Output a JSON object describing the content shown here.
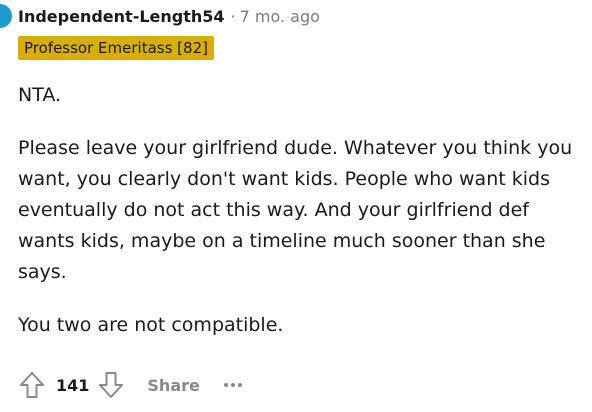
{
  "comment": {
    "author": "Independent-Length54",
    "separator": "·",
    "time": "7 mo. ago",
    "flair": "Professor Emeritass [82]",
    "paragraphs": [
      "NTA.",
      "Please leave your girlfriend dude. Whatever you think you want, you clearly don't want kids. People who want kids eventually do not act this way. And your girlfriend def wants kids, maybe on a timeline much sooner than she says.",
      "You two are not compatible."
    ],
    "score": "141",
    "share_label": "Share",
    "more_label": "···"
  },
  "icons": {
    "upvote": "upvote-arrow-icon",
    "downvote": "downvote-arrow-icon",
    "more": "more-options-icon"
  },
  "colors": {
    "flair_bg": "#d7ae06",
    "avatar": "#1d9bd1",
    "muted": "#878a8c"
  }
}
